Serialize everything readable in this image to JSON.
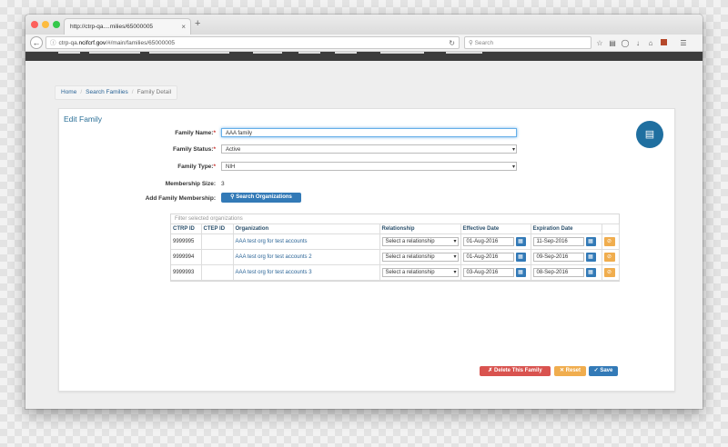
{
  "browser": {
    "tab_title": "http://ctrp-qa....milies/65000005",
    "tab_close": "×",
    "new_tab": "+",
    "url_prefix": "ctrp-qa.",
    "url_host": "ncifcrf.gov",
    "url_path": "/#/main/families/65000005",
    "search_placeholder": "Search",
    "icons": [
      "star-icon",
      "reading-list-icon",
      "pocket-icon",
      "download-icon",
      "home-icon",
      "addon-icon",
      "menu-icon"
    ]
  },
  "breadcrumb": [
    "Home",
    "Search Families",
    "Family Detail"
  ],
  "panel": {
    "title": "Edit Family",
    "fields": {
      "name_label": "Family Name:",
      "name_value": "AAA family",
      "status_label": "Family Status:",
      "status_value": "Active",
      "type_label": "Family Type:",
      "type_value": "NIH",
      "size_label": "Membership Size:",
      "size_value": "3",
      "membership_label": "Add Family Membership:",
      "search_orgs_button": "Search Organizations"
    },
    "grid": {
      "filter_placeholder": "Filter selected organizations",
      "columns": [
        "CTRP ID",
        "CTEP ID",
        "Organization",
        "Relationship",
        "Effective Date",
        "Expiration Date",
        ""
      ],
      "rows": [
        {
          "ctrp_id": "9999995",
          "ctep_id": "",
          "organization": "AAA test org for test accounts",
          "relationship": "Select a relationship",
          "effective": "01-Aug-2016",
          "expiration": "11-Sep-2016"
        },
        {
          "ctrp_id": "9999994",
          "ctep_id": "",
          "organization": "AAA test org for test accounts 2",
          "relationship": "Select a relationship",
          "effective": "01-Aug-2016",
          "expiration": "09-Sep-2016"
        },
        {
          "ctrp_id": "9999993",
          "ctep_id": "",
          "organization": "AAA test org for test accounts 3",
          "relationship": "Select a relationship",
          "effective": "03-Aug-2016",
          "expiration": "08-Sep-2016"
        }
      ]
    },
    "buttons": {
      "delete": "Delete This Family",
      "reset": "Reset",
      "save": "Save"
    }
  },
  "colors": {
    "primary": "#337ab7",
    "danger": "#d9534f",
    "warning": "#f0ad4e",
    "fab": "#1f6fa0"
  }
}
